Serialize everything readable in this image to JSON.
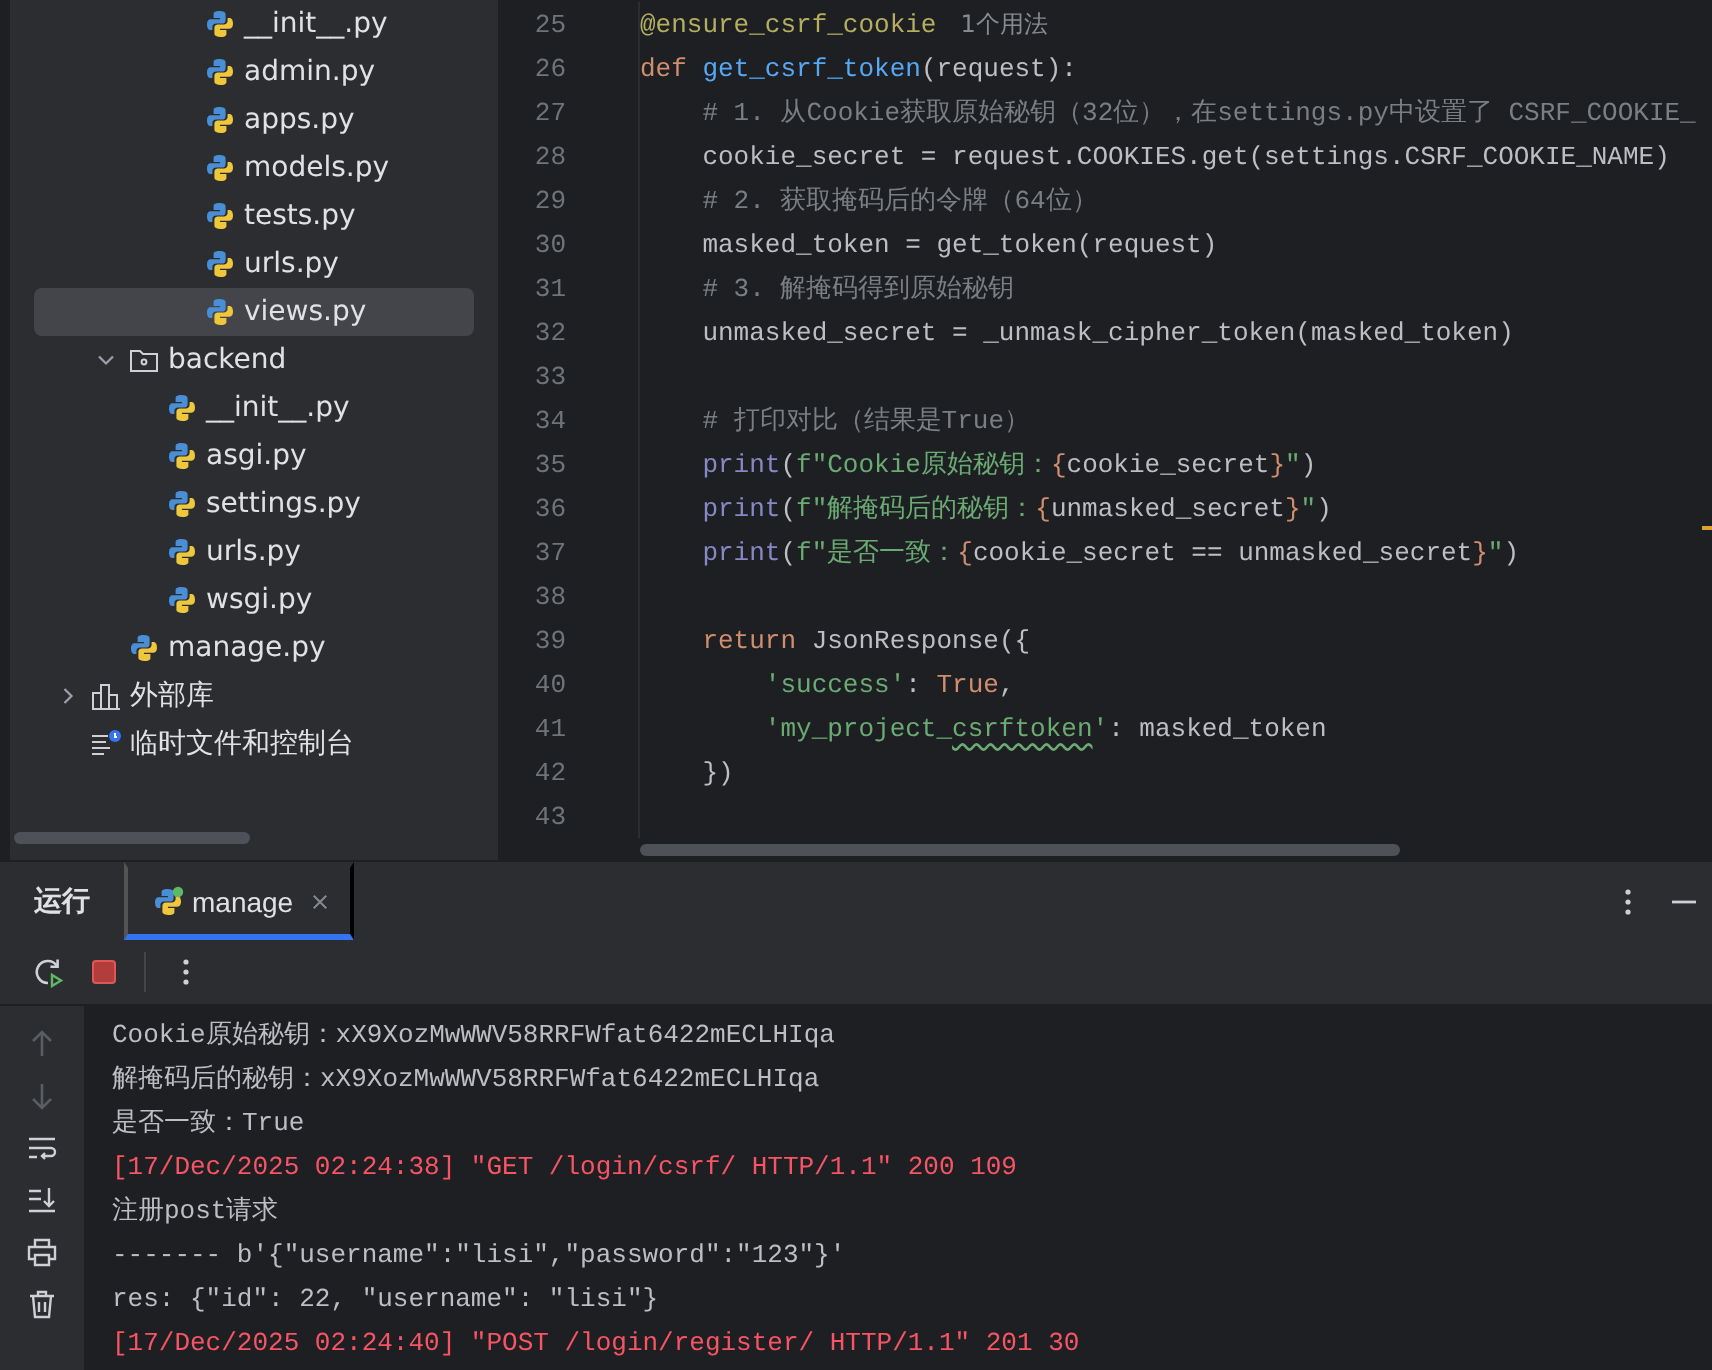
{
  "project_tree": {
    "items": [
      {
        "children": [
          {
            "children": [
              {
                "children": [
                  {
                    "kind": "file",
                    "label": "__init__.py",
                    "selected": false
                  },
                  {
                    "kind": "file",
                    "label": "admin.py",
                    "selected": false
                  },
                  {
                    "kind": "file",
                    "label": "apps.py",
                    "selected": false
                  },
                  {
                    "kind": "file",
                    "label": "models.py",
                    "selected": false
                  },
                  {
                    "kind": "file",
                    "label": "tests.py",
                    "selected": false
                  },
                  {
                    "kind": "file",
                    "label": "urls.py",
                    "selected": false
                  },
                  {
                    "kind": "file",
                    "label": "views.py",
                    "selected": true
                  }
                ]
              }
            ]
          },
          {
            "kind": "folder",
            "label": "backend",
            "expanded": true,
            "selected": false,
            "children": [
              {
                "kind": "file",
                "label": "__init__.py",
                "selected": false
              },
              {
                "kind": "file",
                "label": "asgi.py",
                "selected": false
              },
              {
                "kind": "file",
                "label": "settings.py",
                "selected": false
              },
              {
                "kind": "file",
                "label": "urls.py",
                "selected": false
              },
              {
                "kind": "file",
                "label": "wsgi.py",
                "selected": false
              }
            ]
          },
          {
            "kind": "file",
            "label": "manage.py",
            "selected": false
          }
        ]
      },
      {
        "kind": "library",
        "label": "外部库",
        "expanded": false,
        "selected": false
      },
      {
        "kind": "scratches",
        "label": "临时文件和控制台",
        "selected": false
      }
    ]
  },
  "editor": {
    "lines": [
      {
        "number": "25",
        "tokens": [
          {
            "kind": "deco",
            "text": "@ensure_csrf_cookie"
          }
        ],
        "hint": "1个用法"
      },
      {
        "number": "26",
        "tokens": [
          {
            "kind": "kw",
            "text": "def "
          },
          {
            "kind": "fn",
            "text": "get_csrf_token"
          },
          {
            "kind": "plain",
            "text": "(request):"
          }
        ]
      },
      {
        "number": "27",
        "tokens": [
          {
            "kind": "comment",
            "text": "    # 1. 从Cookie获取原始秘钥（32位），在settings.py中设置了 CSRF_COOKIE_"
          }
        ]
      },
      {
        "number": "28",
        "tokens": [
          {
            "kind": "plain",
            "text": "    cookie_secret = request.COOKIES.get(settings.CSRF_COOKIE_NAME)"
          }
        ]
      },
      {
        "number": "29",
        "tokens": [
          {
            "kind": "comment",
            "text": "    # 2. 获取掩码后的令牌（64位）"
          }
        ]
      },
      {
        "number": "30",
        "tokens": [
          {
            "kind": "plain",
            "text": "    masked_token = get_token(request)"
          }
        ]
      },
      {
        "number": "31",
        "tokens": [
          {
            "kind": "comment",
            "text": "    # 3. 解掩码得到原始秘钥"
          }
        ]
      },
      {
        "number": "32",
        "tokens": [
          {
            "kind": "plain",
            "text": "    unmasked_secret = _unmask_cipher_token(masked_token)"
          }
        ]
      },
      {
        "number": "33"
      },
      {
        "number": "34",
        "tokens": [
          {
            "kind": "comment",
            "text": "    # 打印对比（结果是True）"
          }
        ]
      },
      {
        "number": "35",
        "tokens": [
          {
            "kind": "builtin",
            "text": "    print"
          },
          {
            "kind": "plain",
            "text": "("
          },
          {
            "kind": "str",
            "text": "f\"Cookie原始秘钥："
          },
          {
            "kind": "brace",
            "text": "{"
          },
          {
            "kind": "plain",
            "text": "cookie_secret"
          },
          {
            "kind": "brace",
            "text": "}"
          },
          {
            "kind": "str",
            "text": "\""
          },
          {
            "kind": "plain",
            "text": ")"
          }
        ]
      },
      {
        "number": "36",
        "tokens": [
          {
            "kind": "builtin",
            "text": "    print"
          },
          {
            "kind": "plain",
            "text": "("
          },
          {
            "kind": "str",
            "text": "f\"解掩码后的秘钥："
          },
          {
            "kind": "brace",
            "text": "{"
          },
          {
            "kind": "plain",
            "text": "unmasked_secret"
          },
          {
            "kind": "brace",
            "text": "}"
          },
          {
            "kind": "str",
            "text": "\""
          },
          {
            "kind": "plain",
            "text": ")"
          }
        ]
      },
      {
        "number": "37",
        "tokens": [
          {
            "kind": "builtin",
            "text": "    print"
          },
          {
            "kind": "plain",
            "text": "("
          },
          {
            "kind": "str",
            "text": "f\"是否一致："
          },
          {
            "kind": "brace",
            "text": "{"
          },
          {
            "kind": "plain",
            "text": "cookie_secret == unmasked_secret"
          },
          {
            "kind": "brace",
            "text": "}"
          },
          {
            "kind": "str",
            "text": "\""
          },
          {
            "kind": "plain",
            "text": ")"
          }
        ]
      },
      {
        "number": "38"
      },
      {
        "number": "39",
        "tokens": [
          {
            "kind": "kw",
            "text": "    return "
          },
          {
            "kind": "plain",
            "text": "JsonResponse({"
          }
        ]
      },
      {
        "number": "40",
        "tokens": [
          {
            "kind": "str",
            "text": "        'success'"
          },
          {
            "kind": "plain",
            "text": ": "
          },
          {
            "kind": "kw",
            "text": "True"
          },
          {
            "kind": "plain",
            "text": ","
          }
        ]
      },
      {
        "number": "41",
        "tokens": [
          {
            "kind": "str",
            "text": "        'my_project_"
          },
          {
            "kind": "str",
            "text": "csrftoken",
            "typo": true
          },
          {
            "kind": "str",
            "text": "'"
          },
          {
            "kind": "plain",
            "text": ": masked_token"
          }
        ]
      },
      {
        "number": "42",
        "tokens": [
          {
            "kind": "plain",
            "text": "    })"
          }
        ]
      },
      {
        "number": "43"
      }
    ]
  },
  "run_panel": {
    "title": "运行",
    "tabs": [
      {
        "label": "manage",
        "selected": true
      }
    ],
    "console": {
      "lines": [
        {
          "kind": "stdout",
          "text": "Cookie原始秘钥：xX9XozMwWWV58RRFWfat6422mECLHIqa"
        },
        {
          "kind": "stdout",
          "text": "解掩码后的秘钥：xX9XozMwWWV58RRFWfat6422mECLHIqa"
        },
        {
          "kind": "stdout",
          "text": "是否一致：True"
        },
        {
          "kind": "stderr",
          "text": "[17/Dec/2025 02:24:38] \"GET /login/csrf/ HTTP/1.1\" 200 109"
        },
        {
          "kind": "stdout",
          "text": "注册post请求"
        },
        {
          "kind": "stdout",
          "text": "------- b'{\"username\":\"lisi\",\"password\":\"123\"}'"
        },
        {
          "kind": "stdout",
          "text": "res: {\"id\": 22, \"username\": \"lisi\"}"
        },
        {
          "kind": "stderr",
          "text": "[17/Dec/2025 02:24:40] \"POST /login/register/ HTTP/1.1\" 201 30"
        }
      ]
    }
  }
}
